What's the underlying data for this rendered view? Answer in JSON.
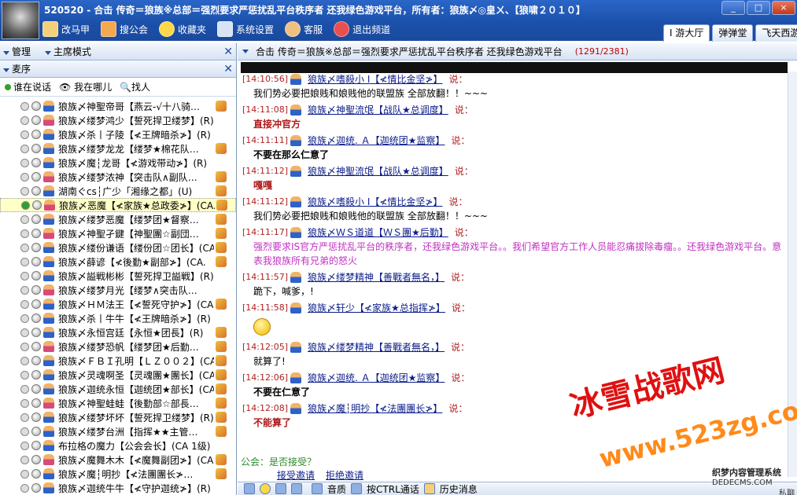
{
  "window": {
    "title": "520520 - 合击 传奇＝狼族※总部＝强烈要求严惩扰乱平台秩序者 还我绿色游戏平台，所有者：狼族〆◎皇ㄨ、【狼啸２０１０】",
    "buttons": [
      "_",
      "□",
      "×"
    ]
  },
  "toolbar": {
    "items": [
      {
        "label": "改马甲",
        "icon": "card-icon",
        "color": "#f4d078"
      },
      {
        "label": "搜公会",
        "icon": "people-icon",
        "color": "#f4a850"
      },
      {
        "label": "收藏夹",
        "icon": "star-icon",
        "color": "#ffd84a"
      },
      {
        "label": "系统设置",
        "icon": "settings-icon",
        "color": "#d8e4f4"
      },
      {
        "label": "客服",
        "icon": "service-icon",
        "color": "#f0c080"
      },
      {
        "label": "退出频道",
        "icon": "power-icon",
        "color": "#e85050"
      }
    ]
  },
  "hall_tabs": [
    "I 游大厅",
    "弹弹堂",
    "飞天西游"
  ],
  "left_panel": {
    "manage": "管理",
    "mode": "主席模式",
    "order": "麦序",
    "filters": [
      "谁在说话",
      "我在哪儿",
      "找人"
    ],
    "users": [
      "狼族〆神聖帝哥【燕云-√十八骑…",
      "狼族〆缕梦鸿少【誓死捍卫缕梦】(R)",
      "狼族〆杀丨子陵【≮王牌暗杀≯】(R)",
      "狼族〆缕梦龙龙【缕梦★棉花队…",
      "狼族〆魔┆龙哥【≮游戏带动≯】(R)",
      "狼族〆缕梦浓神【突击队∧副队…",
      "湖南ぐcs┆广少「湘缘之都」(U)",
      "狼族〆恶魔【≮家族★总政委≯】(CA.",
      "狼族〆缕梦恶魔【缕梦团★督察…",
      "狼族〆神聖孑鍵【神聖團☆副団…",
      "狼族〆缕份谦语【缕份团☆团长】(CA.",
      "狼族〆薛谚【≮後勤★副部≯】(CA.",
      "狼族〆謚戦彬彬【誓死捍卫謚戦】(R)",
      "狼族〆缕梦月光【缕梦∧突击队…",
      "狼族〆ＨＭ法王【≮誓死守护≯】(CA.",
      "狼族〆杀丨牛牛【≮王牌暗杀≯】(R)",
      "狼族〆永恒宫廷【永恒★团長】(R)",
      "狼族〆缕梦恐帆【缕梦团★后勤…",
      "狼族〆ＦＢＩ孔明【ＬＺ００２】(CA.",
      "狼族〆灵魂啊圣【灵魂團★團长】(CA.",
      "狼族〆迦统永恒【迦统团★部长】(CA.",
      "狼族〆神聖蛙蛙【後勤部☆部長…",
      "狼族〆缕梦坏坏【誓死捍卫缕梦】(R)",
      "狼族〆缕梦台洲【指挥★★主管…",
      "布拉格の魔力【公会会长】(CA 1级)",
      "狼族〆魔舞木木【≮魔舞副团≯】(CA.",
      "狼族〆魔┆明抄【≮法團團长≯…",
      "狼族〆迦统牛牛【≮守护迦统≯】(R)"
    ]
  },
  "channel": {
    "title": "合击 传奇＝狼族※总部＝强烈要求严惩扰乱平台秩序者 还我绿色游戏平台",
    "count": "(1291/2381)",
    "says": "说：",
    "messages": [
      {
        "time": "[14:10:56]",
        "sender": "狼族〆嗜殺小 I【≮情比金坚≯】",
        "text": "我们势必要把娘贱和娘贱他的联盟族    全部放翻！！~~~",
        "style": "normal"
      },
      {
        "time": "[14:11:08]",
        "sender": "狼族〆神聖流氓【战队★总调度】",
        "text": "直接冲官方",
        "style": "red"
      },
      {
        "time": "[14:11:11]",
        "sender": "狼族〆迦统. Ａ【迦统团★监察】",
        "text": "不要在那么仁意了",
        "style": "bold"
      },
      {
        "time": "[14:11:12]",
        "sender": "狼族〆神聖流氓【战队★总调度】",
        "text": "嘎嘎",
        "style": "red"
      },
      {
        "time": "[14:11:12]",
        "sender": "狼族〆嗜殺小 I【≮情比金坚≯】",
        "text": "我们势必要把娘贱和娘贱他的联盟族    全部放翻！！~~~",
        "style": "normal"
      },
      {
        "time": "[14:11:17]",
        "sender": "狼族〆ＷＳ道道【ＷＳ團★后勤】",
        "text": "强烈要求IS官方严惩扰乱平台的秩序者，还我绿色游戏平台。。我们希望官方工作人员能忍痛拔除毒瘤。。还我绿色游戏平台。意表我狼族所有兄弟的怒火",
        "style": "pink"
      },
      {
        "time": "[14:11:57]",
        "sender": "狼族〆缕梦精神【善戰者無名，】",
        "text": "跪下，喊爹，!",
        "style": "normal"
      },
      {
        "time": "[14:11:58]",
        "sender": "狼族〆轩少【≮家族★总指挥≯】",
        "text": "",
        "style": "emoji"
      },
      {
        "time": "[14:12:05]",
        "sender": "狼族〆缕梦精神【善戰者無名，】",
        "text": "就算了!",
        "style": "normal"
      },
      {
        "time": "[14:12:06]",
        "sender": "狼族〆迦统. Ａ【迦统团★监察】",
        "text": "不要在仁意了",
        "style": "bold"
      },
      {
        "time": "[14:12:08]",
        "sender": "狼族〆魔┆明抄【≮法團團长≯】",
        "text": "不能算了",
        "style": "red"
      }
    ],
    "invite": {
      "question": "公会：是否接受？",
      "accept": "接受邀请",
      "reject": "拒绝邀请"
    }
  },
  "bottombar": {
    "audio": "音质",
    "ctrl_talk": "按CTRL通话",
    "history": "历史消息"
  },
  "watermark": {
    "line1": "冰雪战歌网",
    "line2": "www.523zg.com",
    "dede1": "织梦内容管理系统",
    "dede2": "DEDECMS.COM",
    "private": "私聊"
  }
}
